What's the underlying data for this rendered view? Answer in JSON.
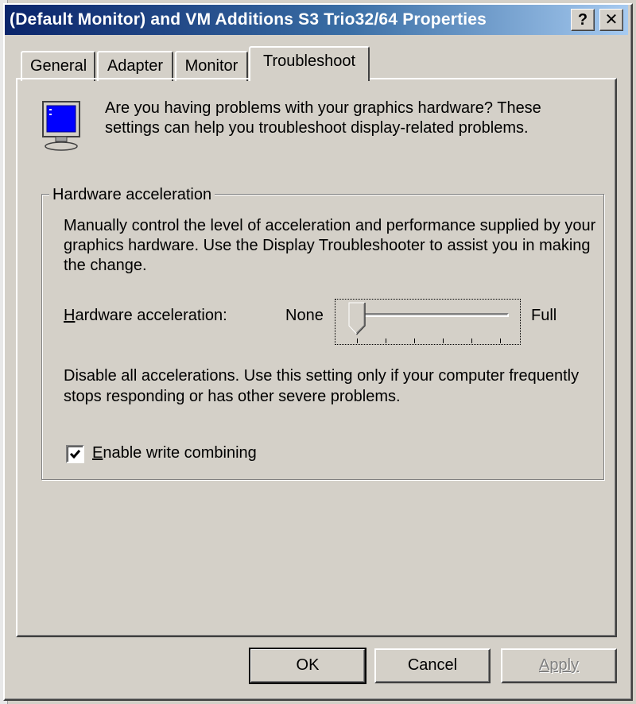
{
  "window": {
    "title": "(Default Monitor) and VM Additions S3 Trio32/64 Properties",
    "help_label": "?",
    "close_label": "✕"
  },
  "tabs": [
    {
      "label": "General",
      "active": false
    },
    {
      "label": "Adapter",
      "active": false
    },
    {
      "label": "Monitor",
      "active": false
    },
    {
      "label": "Troubleshoot",
      "active": true
    }
  ],
  "intro": {
    "icon": "monitor-icon",
    "text": "Are you having problems with your graphics hardware? These settings can help you troubleshoot display-related problems."
  },
  "hardware_group": {
    "legend": "Hardware acceleration",
    "description": "Manually control the level of acceleration and performance supplied by your graphics hardware. Use the Display Troubleshooter to assist you in making the change.",
    "slider": {
      "label_prefix": "",
      "label_accel": "H",
      "label_rest": "ardware acceleration:",
      "min_label": "None",
      "max_label": "Full",
      "value": 0,
      "positions": 6
    },
    "setting_description": "Disable all accelerations. Use this setting only if your computer frequently stops responding or has other severe problems.",
    "write_combining": {
      "checked": true,
      "label_accel": "E",
      "label_rest": "nable write combining"
    }
  },
  "buttons": {
    "ok": "OK",
    "cancel": "Cancel",
    "apply": "Apply"
  }
}
